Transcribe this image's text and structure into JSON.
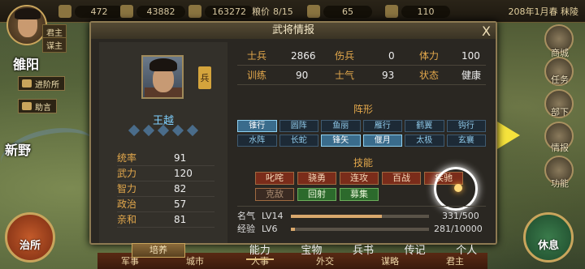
{
  "topbar": {
    "res1": "472",
    "res2": "43882",
    "res3": "163272",
    "grain_label": "粮价",
    "grain_value": "8/15",
    "res4": "65",
    "res5": "110",
    "date": "208年1月春 秣陵"
  },
  "lord": {
    "tag1": "君主",
    "tag2": "谋主"
  },
  "map": {
    "city1": "雒阳",
    "city2": "新野",
    "btn_advance": "进阶所",
    "btn_help": "助言"
  },
  "side_menu": [
    "商城",
    "任务",
    "部下",
    "情报",
    "功能"
  ],
  "big_buttons": {
    "left": "治所",
    "right": "休息"
  },
  "bottom_menu": [
    "军事",
    "城市",
    "人事",
    "外交",
    "谋略",
    "君主"
  ],
  "dialog": {
    "title": "武将情报",
    "close": "X",
    "badge": "兵",
    "general_name": "王越",
    "stats": [
      {
        "k": "统率",
        "v": "91"
      },
      {
        "k": "武力",
        "v": "120"
      },
      {
        "k": "智力",
        "v": "82"
      },
      {
        "k": "政治",
        "v": "57"
      },
      {
        "k": "亲和",
        "v": "81"
      }
    ],
    "train_button": "培养",
    "info": {
      "soldier_k": "士兵",
      "soldier_v": "2866",
      "wounded_k": "伤兵",
      "wounded_v": "0",
      "stamina_k": "体力",
      "stamina_v": "100",
      "training_k": "训练",
      "training_v": "90",
      "morale_k": "士气",
      "morale_v": "93",
      "status_k": "状态",
      "status_v": "健康"
    },
    "formation_title": "阵形",
    "formations": [
      {
        "label": "锥行",
        "active": true
      },
      {
        "label": "圆阵",
        "active": false
      },
      {
        "label": "鱼丽",
        "active": false
      },
      {
        "label": "雁行",
        "active": false
      },
      {
        "label": "鹤翼",
        "active": false
      },
      {
        "label": "钩行",
        "active": false
      },
      {
        "label": "水阵",
        "active": false
      },
      {
        "label": "长蛇",
        "active": false
      },
      {
        "label": "锋矢",
        "active": true
      },
      {
        "label": "偃月",
        "active": true
      },
      {
        "label": "太极",
        "active": false
      },
      {
        "label": "玄襄",
        "active": false
      }
    ],
    "skills_title": "技能",
    "skills": [
      {
        "label": "叱咤",
        "style": "red"
      },
      {
        "label": "骁勇",
        "style": "red"
      },
      {
        "label": "连攻",
        "style": "red"
      },
      {
        "label": "百战",
        "style": "red"
      },
      {
        "label": "疾驰",
        "style": "red"
      },
      {
        "label": "克敌",
        "style": "dim"
      },
      {
        "label": "回射",
        "style": "green"
      },
      {
        "label": "募集",
        "style": "green"
      }
    ],
    "fame_k": "名气",
    "fame_lv": "LV14",
    "fame_val": "331/500",
    "fame_pct": 0.66,
    "exp_k": "经验",
    "exp_lv": "LV6",
    "exp_val": "281/10000",
    "exp_pct": 0.03,
    "tabs": [
      "能力",
      "宝物",
      "兵书",
      "传记",
      "个人"
    ],
    "active_tab": 0
  }
}
